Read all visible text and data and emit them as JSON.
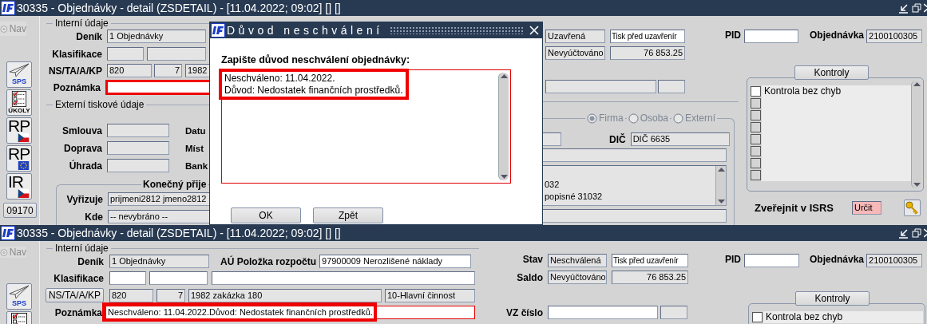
{
  "upper_window": {
    "title": "30335 - Objednávky - detail (ZSDETAIL) - [11.04.2022; 09:02] [] []",
    "nav": {
      "label": "Nav",
      "disabled": true
    },
    "toolbar": [
      {
        "kind": "plane",
        "label": "SPS"
      },
      {
        "kind": "tasks",
        "label": "ÚKOLY"
      },
      {
        "kind": "flag_cz",
        "label": "RP"
      },
      {
        "kind": "flag_eu",
        "label": "RP"
      },
      {
        "kind": "flag_cz",
        "label": "IR"
      }
    ],
    "code_button": "09170",
    "internal": {
      "heading": "Interní údaje",
      "denik": {
        "label": "Deník",
        "field": {
          "value": "1 Objednávky",
          "editable": false
        }
      },
      "klasifikace": {
        "label": "Klasifikace",
        "fields": [
          {
            "editable": false
          },
          {
            "editable": false
          }
        ]
      },
      "ns": {
        "kind": "label",
        "label": "NS/TA/A/KP",
        "fields": [
          {
            "value": "820",
            "editable": false
          },
          {
            "value": "7",
            "editable": false
          },
          {
            "value": "1982",
            "editable": false
          }
        ]
      },
      "poznamka": {
        "label": "Poznámka",
        "field": {
          "editable": true,
          "highlighted": true
        }
      }
    },
    "external": {
      "heading": "Externí tiskové údaje",
      "rows": [
        {
          "label": "Smlouva",
          "field": {
            "editable": false
          },
          "label_2": "Datu"
        },
        {
          "label": "Doprava",
          "field": {
            "editable": false
          },
          "label_2": "Míst"
        },
        {
          "label": "Úhrada",
          "field": {
            "editable": false
          },
          "label_2": "Bank"
        }
      ]
    },
    "recipient": {
      "heading": "Konečný přije",
      "rows": [
        {
          "label": "Vyřizuje",
          "field": {
            "value": "prijmeni2812 jmeno2812",
            "editable": false
          }
        },
        {
          "label": "Kde",
          "field": {
            "value": "-- nevybráno --",
            "editable": false
          }
        }
      ]
    },
    "status": {
      "fields": [
        {
          "value": "Uzavřená",
          "editable": false
        },
        {
          "value": "Tisk před uzavřenír",
          "editable": true
        }
      ]
    },
    "saldo": {
      "fields": [
        {
          "value": "Nevyúčtováno",
          "editable": false
        },
        {
          "value": "76 853.25",
          "editable": false
        }
      ]
    },
    "extra": {
      "fields": [
        {
          "editable": false
        },
        {
          "editable": false
        }
      ]
    },
    "pid": {
      "label": "PID",
      "field": {
        "editable": true
      }
    },
    "order": {
      "label": "Objednávka",
      "field": {
        "value": "2100100305",
        "editable": false
      }
    },
    "partner": {
      "disabled": true,
      "options": [
        {
          "label": "Firma",
          "selected": true
        },
        {
          "label": "Osoba",
          "selected": false
        },
        {
          "label": "Externí",
          "selected": false
        }
      ],
      "first": {
        "editable": false
      },
      "dic": {
        "label": "DIČ",
        "field": {
          "value": "DIČ 6635",
          "editable": false
        }
      },
      "name": {
        "editable": false
      },
      "address_lines": [
        "032",
        "popisné 31032"
      ],
      "last": {
        "editable": false
      }
    },
    "checks": {
      "button": "Kontroly",
      "items": [
        {
          "label": "Kontrola bez chyb",
          "checked": false
        },
        {
          "checked": false
        },
        {
          "checked": false
        },
        {
          "checked": false
        },
        {
          "checked": false
        },
        {
          "checked": false
        },
        {
          "checked": false
        },
        {
          "checked": false
        }
      ]
    },
    "publish": {
      "label": "Zveřejnit v ISRS",
      "field": {
        "value": "Určit",
        "warning": true
      }
    }
  },
  "dialog": {
    "title": "Důvod neschválení",
    "prompt": "Zapište důvod neschválení objednávky:",
    "text_lines": [
      "Neschváleno: 11.04.2022.",
      "Důvod: Nedostatek finančních prostředků."
    ],
    "highlighted": true,
    "buttons": [
      "OK",
      "Zpět"
    ]
  },
  "lower_window": {
    "title": "30335 - Objednávky - detail (ZSDETAIL) - [11.04.2022; 09:02] [] []",
    "nav": {
      "label": "Nav",
      "disabled": true
    },
    "toolbar": [
      {
        "kind": "plane",
        "label": "SPS"
      },
      {
        "kind": "tasks"
      }
    ],
    "internal": {
      "heading": "Interní údaje",
      "denik": {
        "label": "Deník",
        "field": {
          "value": "1 Objednávky",
          "editable": false
        }
      },
      "budget": {
        "label": "AÚ Položka rozpočtu",
        "field": {
          "value": "97900009 Nerozlišené náklady",
          "editable": true
        }
      },
      "klasifikace": {
        "label": "Klasifikace",
        "fields": [
          {
            "editable": true
          },
          {
            "editable": true
          },
          {
            "editable": true
          }
        ]
      },
      "ns": {
        "kind": "button",
        "label": "NS/TA/A/KP",
        "fields": [
          {
            "value": "820",
            "editable": false
          },
          {
            "value": "7",
            "editable": false
          },
          {
            "value": "1982 zakázka 180",
            "editable": false
          },
          {
            "value": "10-Hlavní činnost",
            "editable": false
          }
        ]
      },
      "poznamka": {
        "label": "Poznámka",
        "field": {
          "value": "Neschváleno: 11.04.2022.Důvod: Nedostatek finančních prostředků.",
          "editable": true,
          "required": true,
          "highlighted": true
        }
      }
    },
    "status": {
      "label": "Stav",
      "fields": [
        {
          "value": "Neschválená",
          "editable": false
        },
        {
          "value": "Tisk před uzavřenír",
          "editable": true
        }
      ]
    },
    "saldo": {
      "label": "Saldo",
      "fields": [
        {
          "value": "Nevyúčtováno",
          "editable": false
        },
        {
          "value": "76 853.25",
          "editable": false
        }
      ]
    },
    "vz": {
      "label": "VZ číslo",
      "fields": [
        {
          "editable": true
        },
        {
          "editable": false
        }
      ]
    },
    "pid": {
      "label": "PID",
      "field": {
        "editable": true
      }
    },
    "order": {
      "label": "Objednávka",
      "field": {
        "value": "2100100305",
        "editable": false
      }
    },
    "checks": {
      "button": "Kontroly",
      "items": [
        {
          "label": "Kontrola bez chyb",
          "checked": false
        }
      ]
    }
  }
}
